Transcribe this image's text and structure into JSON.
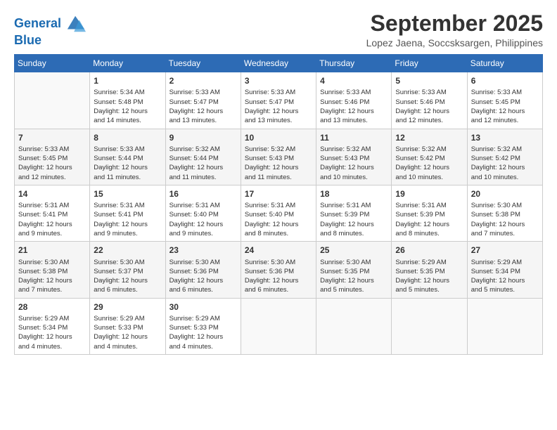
{
  "header": {
    "logo_line1": "General",
    "logo_line2": "Blue",
    "month": "September 2025",
    "location": "Lopez Jaena, Soccsksargen, Philippines"
  },
  "days_of_week": [
    "Sunday",
    "Monday",
    "Tuesday",
    "Wednesday",
    "Thursday",
    "Friday",
    "Saturday"
  ],
  "weeks": [
    [
      {
        "day": "",
        "content": ""
      },
      {
        "day": "1",
        "content": "Sunrise: 5:34 AM\nSunset: 5:48 PM\nDaylight: 12 hours\nand 14 minutes."
      },
      {
        "day": "2",
        "content": "Sunrise: 5:33 AM\nSunset: 5:47 PM\nDaylight: 12 hours\nand 13 minutes."
      },
      {
        "day": "3",
        "content": "Sunrise: 5:33 AM\nSunset: 5:47 PM\nDaylight: 12 hours\nand 13 minutes."
      },
      {
        "day": "4",
        "content": "Sunrise: 5:33 AM\nSunset: 5:46 PM\nDaylight: 12 hours\nand 13 minutes."
      },
      {
        "day": "5",
        "content": "Sunrise: 5:33 AM\nSunset: 5:46 PM\nDaylight: 12 hours\nand 12 minutes."
      },
      {
        "day": "6",
        "content": "Sunrise: 5:33 AM\nSunset: 5:45 PM\nDaylight: 12 hours\nand 12 minutes."
      }
    ],
    [
      {
        "day": "7",
        "content": "Sunrise: 5:33 AM\nSunset: 5:45 PM\nDaylight: 12 hours\nand 12 minutes."
      },
      {
        "day": "8",
        "content": "Sunrise: 5:33 AM\nSunset: 5:44 PM\nDaylight: 12 hours\nand 11 minutes."
      },
      {
        "day": "9",
        "content": "Sunrise: 5:32 AM\nSunset: 5:44 PM\nDaylight: 12 hours\nand 11 minutes."
      },
      {
        "day": "10",
        "content": "Sunrise: 5:32 AM\nSunset: 5:43 PM\nDaylight: 12 hours\nand 11 minutes."
      },
      {
        "day": "11",
        "content": "Sunrise: 5:32 AM\nSunset: 5:43 PM\nDaylight: 12 hours\nand 10 minutes."
      },
      {
        "day": "12",
        "content": "Sunrise: 5:32 AM\nSunset: 5:42 PM\nDaylight: 12 hours\nand 10 minutes."
      },
      {
        "day": "13",
        "content": "Sunrise: 5:32 AM\nSunset: 5:42 PM\nDaylight: 12 hours\nand 10 minutes."
      }
    ],
    [
      {
        "day": "14",
        "content": "Sunrise: 5:31 AM\nSunset: 5:41 PM\nDaylight: 12 hours\nand 9 minutes."
      },
      {
        "day": "15",
        "content": "Sunrise: 5:31 AM\nSunset: 5:41 PM\nDaylight: 12 hours\nand 9 minutes."
      },
      {
        "day": "16",
        "content": "Sunrise: 5:31 AM\nSunset: 5:40 PM\nDaylight: 12 hours\nand 9 minutes."
      },
      {
        "day": "17",
        "content": "Sunrise: 5:31 AM\nSunset: 5:40 PM\nDaylight: 12 hours\nand 8 minutes."
      },
      {
        "day": "18",
        "content": "Sunrise: 5:31 AM\nSunset: 5:39 PM\nDaylight: 12 hours\nand 8 minutes."
      },
      {
        "day": "19",
        "content": "Sunrise: 5:31 AM\nSunset: 5:39 PM\nDaylight: 12 hours\nand 8 minutes."
      },
      {
        "day": "20",
        "content": "Sunrise: 5:30 AM\nSunset: 5:38 PM\nDaylight: 12 hours\nand 7 minutes."
      }
    ],
    [
      {
        "day": "21",
        "content": "Sunrise: 5:30 AM\nSunset: 5:38 PM\nDaylight: 12 hours\nand 7 minutes."
      },
      {
        "day": "22",
        "content": "Sunrise: 5:30 AM\nSunset: 5:37 PM\nDaylight: 12 hours\nand 6 minutes."
      },
      {
        "day": "23",
        "content": "Sunrise: 5:30 AM\nSunset: 5:36 PM\nDaylight: 12 hours\nand 6 minutes."
      },
      {
        "day": "24",
        "content": "Sunrise: 5:30 AM\nSunset: 5:36 PM\nDaylight: 12 hours\nand 6 minutes."
      },
      {
        "day": "25",
        "content": "Sunrise: 5:30 AM\nSunset: 5:35 PM\nDaylight: 12 hours\nand 5 minutes."
      },
      {
        "day": "26",
        "content": "Sunrise: 5:29 AM\nSunset: 5:35 PM\nDaylight: 12 hours\nand 5 minutes."
      },
      {
        "day": "27",
        "content": "Sunrise: 5:29 AM\nSunset: 5:34 PM\nDaylight: 12 hours\nand 5 minutes."
      }
    ],
    [
      {
        "day": "28",
        "content": "Sunrise: 5:29 AM\nSunset: 5:34 PM\nDaylight: 12 hours\nand 4 minutes."
      },
      {
        "day": "29",
        "content": "Sunrise: 5:29 AM\nSunset: 5:33 PM\nDaylight: 12 hours\nand 4 minutes."
      },
      {
        "day": "30",
        "content": "Sunrise: 5:29 AM\nSunset: 5:33 PM\nDaylight: 12 hours\nand 4 minutes."
      },
      {
        "day": "",
        "content": ""
      },
      {
        "day": "",
        "content": ""
      },
      {
        "day": "",
        "content": ""
      },
      {
        "day": "",
        "content": ""
      }
    ]
  ]
}
